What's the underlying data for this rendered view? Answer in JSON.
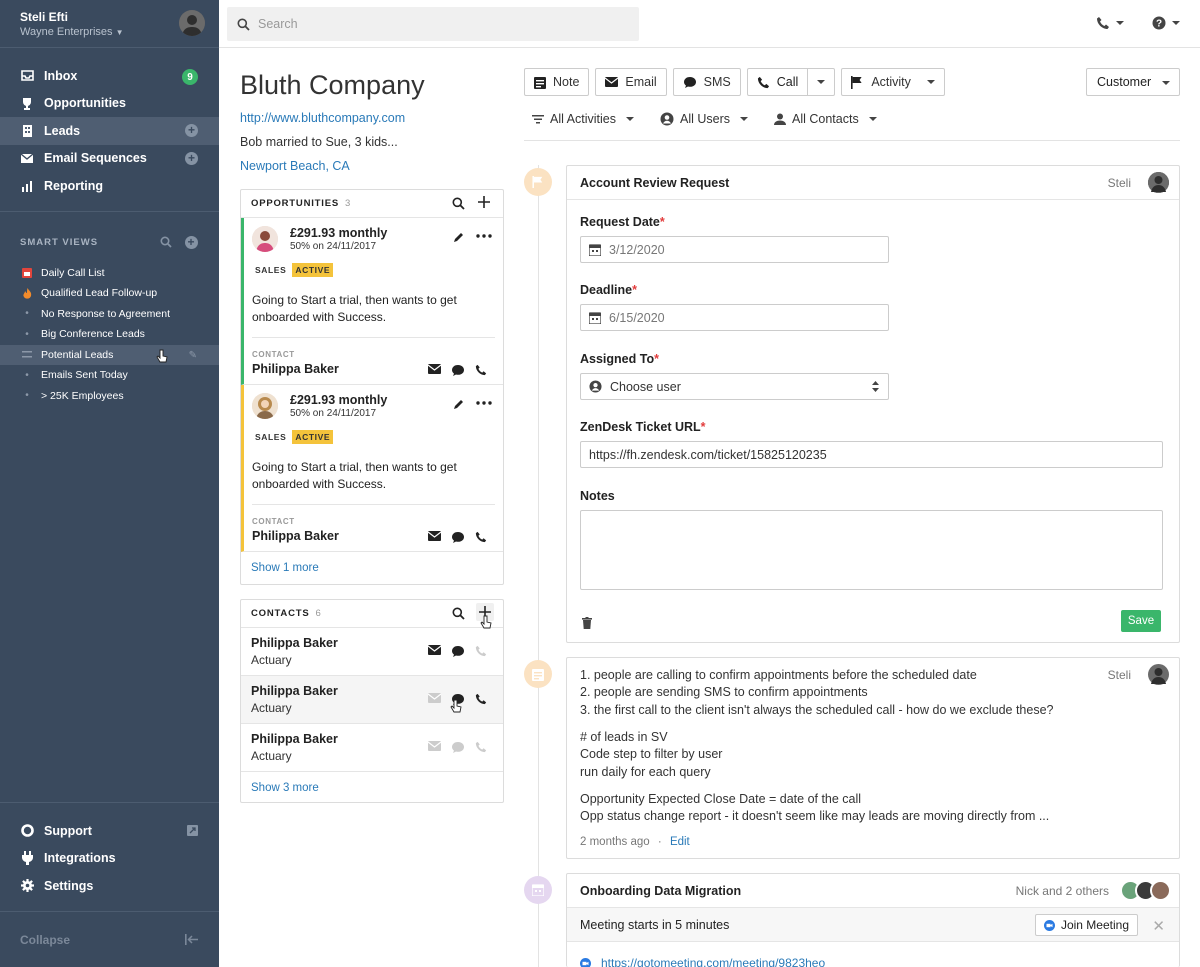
{
  "user": {
    "name": "Steli Efti",
    "org": "Wayne Enterprises"
  },
  "nav": [
    {
      "label": "Inbox",
      "badge": "9",
      "icon": "inbox-icon"
    },
    {
      "label": "Opportunities",
      "icon": "trophy-icon"
    },
    {
      "label": "Leads",
      "icon": "building-icon"
    },
    {
      "label": "Email Sequences",
      "icon": "email-sequence-icon"
    },
    {
      "label": "Reporting",
      "icon": "chart-icon"
    }
  ],
  "smart_views": {
    "heading": "SMART VIEWS",
    "items": [
      "Daily Call List",
      "Qualified Lead Follow-up",
      "No Response to Agreement",
      "Big Conference Leads",
      "Potential Leads",
      "Emails Sent Today",
      "> 25K Employees"
    ]
  },
  "bottom_nav": [
    "Support",
    "Integrations",
    "Settings"
  ],
  "collapse_label": "Collapse",
  "search": {
    "placeholder": "Search"
  },
  "company": {
    "name": "Bluth Company",
    "url": "http://www.bluthcompany.com",
    "description": "Bob  married to Sue, 3 kids...",
    "location": "Newport Beach, CA"
  },
  "opportunities": {
    "heading": "OPPORTUNITIES",
    "count": "3",
    "items": [
      {
        "value": "£291.93 monthly",
        "sub": "50% on 24/11/2017",
        "tag1": "SALES",
        "tag2": "ACTIVE",
        "desc": "Going to Start a trial, then wants to get onboarded with Success.",
        "contact_label": "CONTACT",
        "contact": "Philippa Baker"
      },
      {
        "value": "£291.93 monthly",
        "sub": "50% on 24/11/2017",
        "tag1": "SALES",
        "tag2": "ACTIVE",
        "desc": "Going to Start a trial, then wants to get onboarded with Success.",
        "contact_label": "CONTACT",
        "contact": "Philippa Baker"
      }
    ],
    "show_more": "Show 1 more"
  },
  "contacts": {
    "heading": "CONTACTS",
    "count": "6",
    "items": [
      {
        "name": "Philippa Baker",
        "title": "Actuary"
      },
      {
        "name": "Philippa Baker",
        "title": "Actuary"
      },
      {
        "name": "Philippa Baker",
        "title": "Actuary"
      }
    ],
    "show_more": "Show 3 more"
  },
  "actions": {
    "note": "Note",
    "email": "Email",
    "sms": "SMS",
    "call": "Call",
    "activity": "Activity",
    "status": "Customer"
  },
  "filters": {
    "activities": "All Activities",
    "users": "All Users",
    "contacts": "All Contacts"
  },
  "review": {
    "title": "Account Review Request",
    "author": "Steli",
    "request_date_label": "Request Date",
    "request_date": "3/12/2020",
    "deadline_label": "Deadline",
    "deadline": "6/15/2020",
    "assigned_label": "Assigned To",
    "assigned_placeholder": "Choose user",
    "zendesk_label": "ZenDesk Ticket URL",
    "zendesk_value": "https://fh.zendesk.com/ticket/15825120235",
    "notes_label": "Notes",
    "save": "Save"
  },
  "note": {
    "author": "Steli",
    "lines1": [
      "1. people are calling to confirm appointments before the scheduled date",
      "2. people are sending SMS to confirm appointments",
      "3. the first call to the client isn't always the scheduled call - how do we exclude these?"
    ],
    "lines2": [
      "# of leads in SV",
      "Code step to filter by user",
      "run daily for each query"
    ],
    "lines3": [
      "Opportunity Expected Close Date = date of the call",
      "Opp status change report - it doesn't seem like may leads are moving directly from ..."
    ],
    "time": "2 months ago",
    "edit": "Edit"
  },
  "meeting": {
    "title": "Onboarding Data Migration",
    "attendees": "Nick and 2 others",
    "banner": "Meeting starts in 5 minutes",
    "join": "Join Meeting",
    "link": "https://gotomeeting.com/meeting/9823heo"
  },
  "colors": {
    "sidebar": "#3a4a5e",
    "accent_green": "#3ab66b",
    "link": "#2a7ab8",
    "active_tag": "#f4c33b",
    "timeline_dot": "#fbe2c2"
  }
}
